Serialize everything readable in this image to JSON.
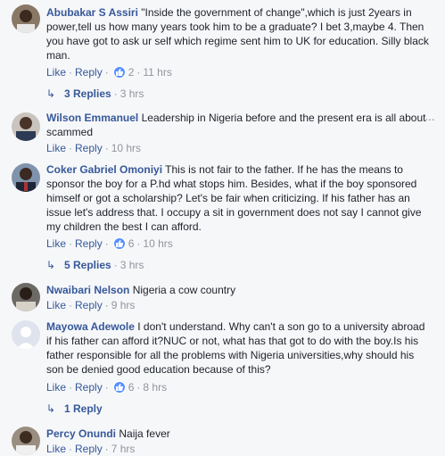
{
  "comments": [
    {
      "author": "Abubakar S Assiri",
      "text": "\"Inside the government of change\",which is just 2years in power,tell us how many years took him to be a graduate? I bet 3,maybe 4. Then you have got to ask ur self which regime sent him to UK for education. Silly black man.",
      "like": "Like",
      "reply": "Reply",
      "reactions": "2",
      "time": "11 hrs",
      "replies": "3 Replies",
      "replies_time": "3 hrs"
    },
    {
      "author": "Wilson Emmanuel",
      "text": "Leadership in Nigeria before and the present era is all about scammed",
      "like": "Like",
      "reply": "Reply",
      "time": "10 hrs"
    },
    {
      "author": "Coker Gabriel Omoniyi",
      "text": "This is not fair to the father. If he has the means to sponsor the boy for a P.hd what stops him. Besides, what if the boy sponsored himself or got a scholarship? Let's be fair when criticizing. If his father has an issue let's address that. I occupy a sit in government does not say I cannot give my children the best I can afford.",
      "like": "Like",
      "reply": "Reply",
      "reactions": "6",
      "time": "10 hrs",
      "replies": "5 Replies",
      "replies_time": "3 hrs"
    },
    {
      "author": "Nwaibari Nelson",
      "text": "Nigeria a cow country",
      "like": "Like",
      "reply": "Reply",
      "time": "9 hrs"
    },
    {
      "author": "Mayowa Adewole",
      "text": "I don't understand. Why can't a son go to a university abroad if his father can afford it?NUC or not, what has that got to do with the boy.Is his father responsible for all the problems with Nigeria universities,why should his son be denied good education because of this?",
      "like": "Like",
      "reply": "Reply",
      "reactions": "6",
      "time": "8 hrs",
      "replies": "1 Reply"
    },
    {
      "author": "Percy Onundi",
      "text": "Naija fever",
      "like": "Like",
      "reply": "Reply",
      "time": "7 hrs"
    }
  ],
  "colors": {
    "link": "#365899",
    "meta": "#90949c",
    "like_badge": "#5890ff",
    "background": "#f6f7f9"
  },
  "icons": {
    "reply_arrow": "↳",
    "more": "···"
  }
}
